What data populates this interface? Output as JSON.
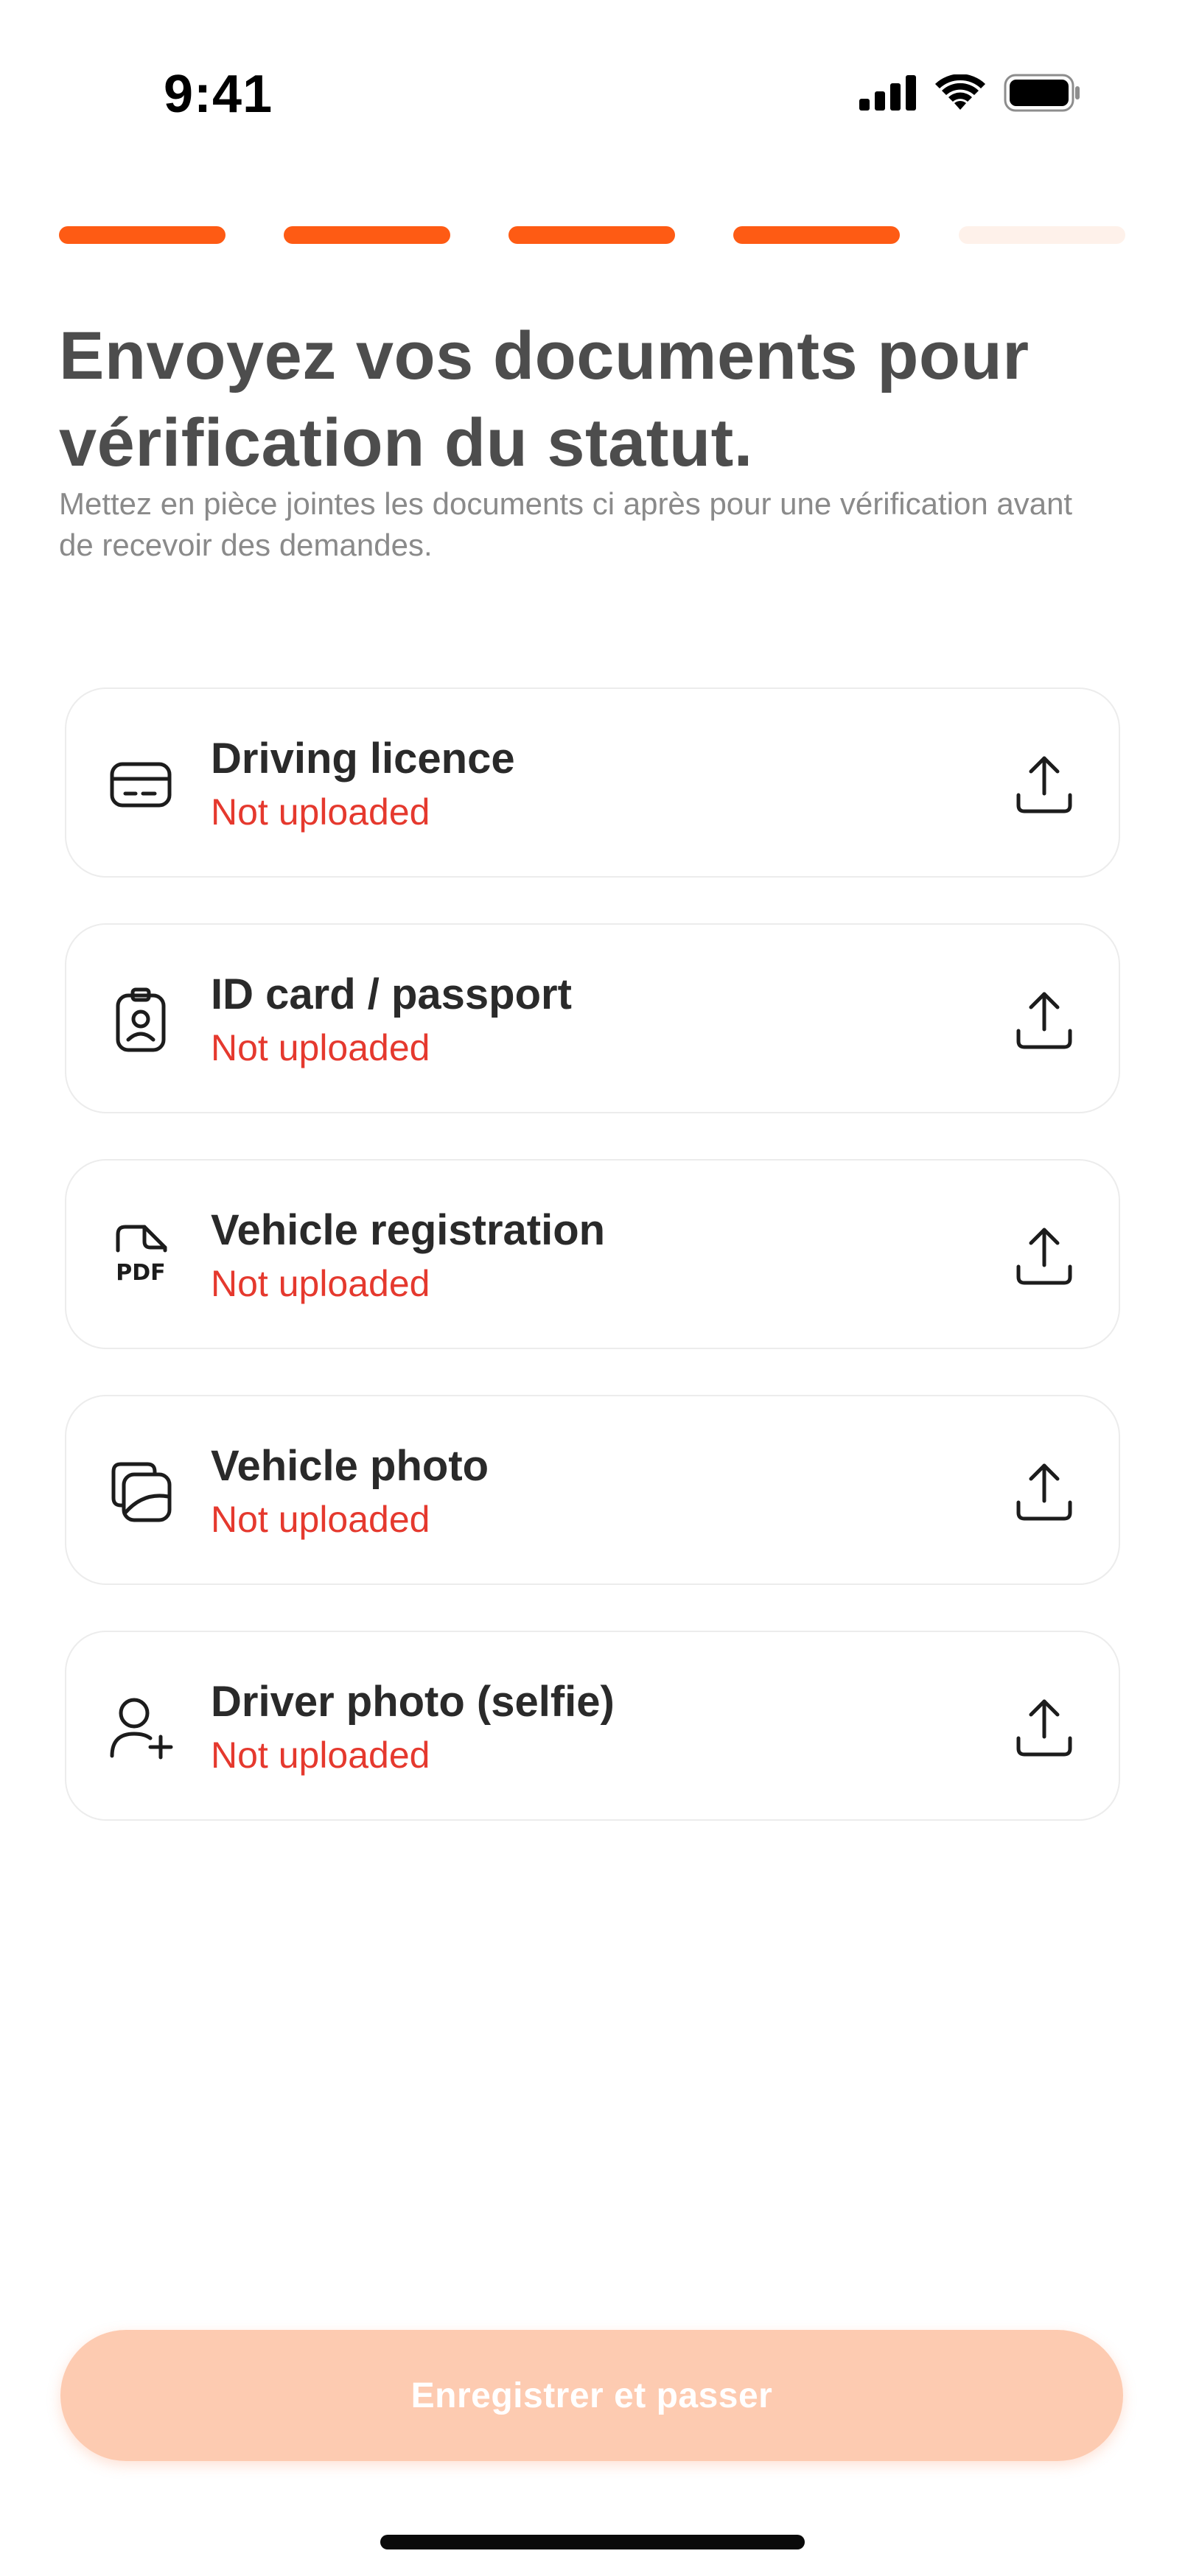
{
  "status_bar": {
    "time": "9:41",
    "icons": [
      "cellular-signal-icon",
      "wifi-icon",
      "battery-icon"
    ]
  },
  "progress": {
    "total_steps": 5,
    "completed_steps": 4,
    "active_color": "#fe5b14",
    "inactive_color": "#fef1ea"
  },
  "header": {
    "title": "Envoyez vos documents pour vérification du statut.",
    "subtitle": "Mettez en pièce jointes les documents ci après pour une vérification avant de recevoir des demandes."
  },
  "documents": [
    {
      "title": "Driving licence",
      "status": "Not uploaded",
      "icon": "card-icon"
    },
    {
      "title": "ID card / passport",
      "status": "Not uploaded",
      "icon": "id-badge-icon"
    },
    {
      "title": "Vehicle registration",
      "status": "Not uploaded",
      "icon": "pdf-file-icon"
    },
    {
      "title": "Vehicle photo",
      "status": "Not uploaded",
      "icon": "photos-icon"
    },
    {
      "title": "Driver photo (selfie)",
      "status": "Not uploaded",
      "icon": "user-add-icon"
    }
  ],
  "colors": {
    "status_error": "#e5392e",
    "button_disabled_bg": "#fdcbb1"
  },
  "actions": {
    "submit_label": "Enregistrer et passer"
  }
}
